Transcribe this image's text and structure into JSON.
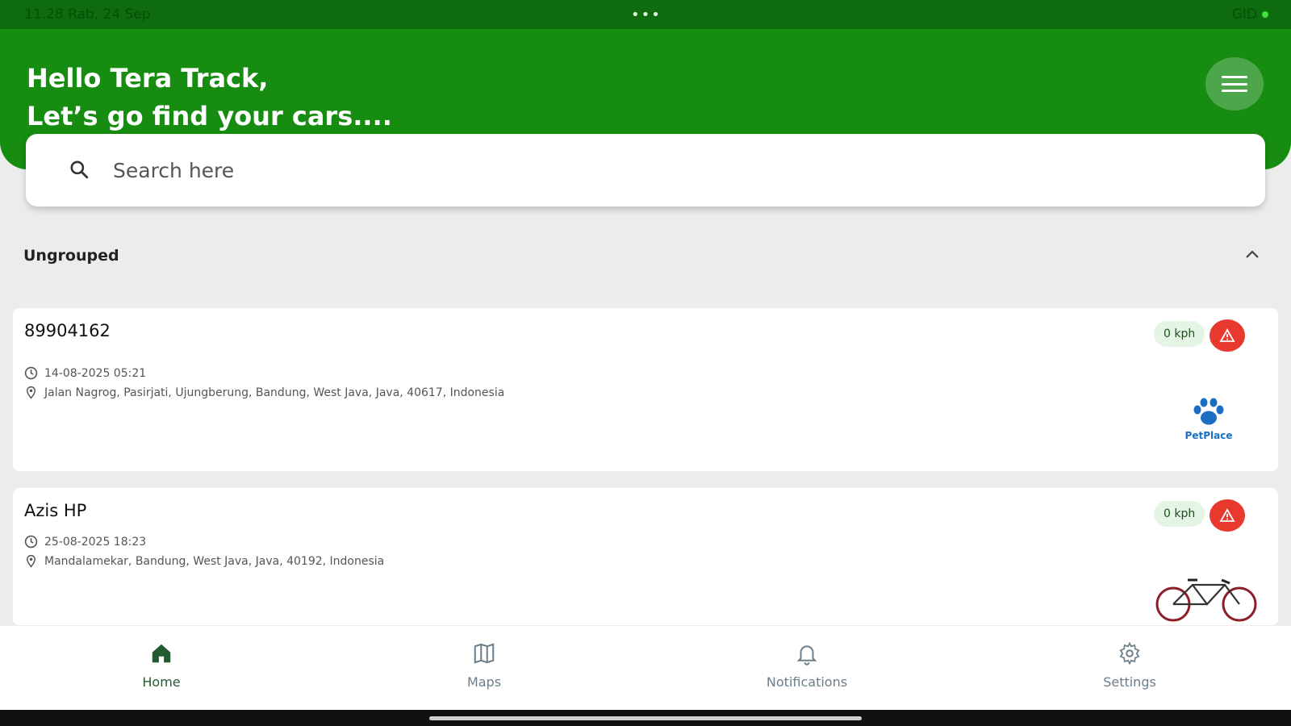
{
  "status_bar": {
    "time": "11.28 Rab, 24 Sep",
    "menu_dots": "•••",
    "right": "GID"
  },
  "header": {
    "greeting_line1": "Hello Tera Track,",
    "greeting_line2": "Let’s go find your cars...."
  },
  "search": {
    "placeholder": "Search here"
  },
  "group": {
    "label": "Ungrouped"
  },
  "vehicles": [
    {
      "name": "89904162",
      "speed": "0 kph",
      "timestamp": "14-08-2025 05:21",
      "address": "Jalan Nagrog, Pasirjati, Ujungberung, Bandung, West Java, Java, 40617, Indonesia",
      "logo_text": "PetPlace"
    },
    {
      "name": "Azis HP",
      "speed": "0 kph",
      "timestamp": "25-08-2025 18:23",
      "address": "Mandalamekar, Bandung, West Java, Java, 40192, Indonesia"
    }
  ],
  "nav": [
    {
      "label": "Home",
      "icon": "home-icon"
    },
    {
      "label": "Maps",
      "icon": "map-icon"
    },
    {
      "label": "Notifications",
      "icon": "bell-icon"
    },
    {
      "label": "Settings",
      "icon": "gear-icon"
    }
  ],
  "colors": {
    "primary": "#168c10",
    "alert": "#e8392e",
    "nav_active": "#245b31"
  }
}
